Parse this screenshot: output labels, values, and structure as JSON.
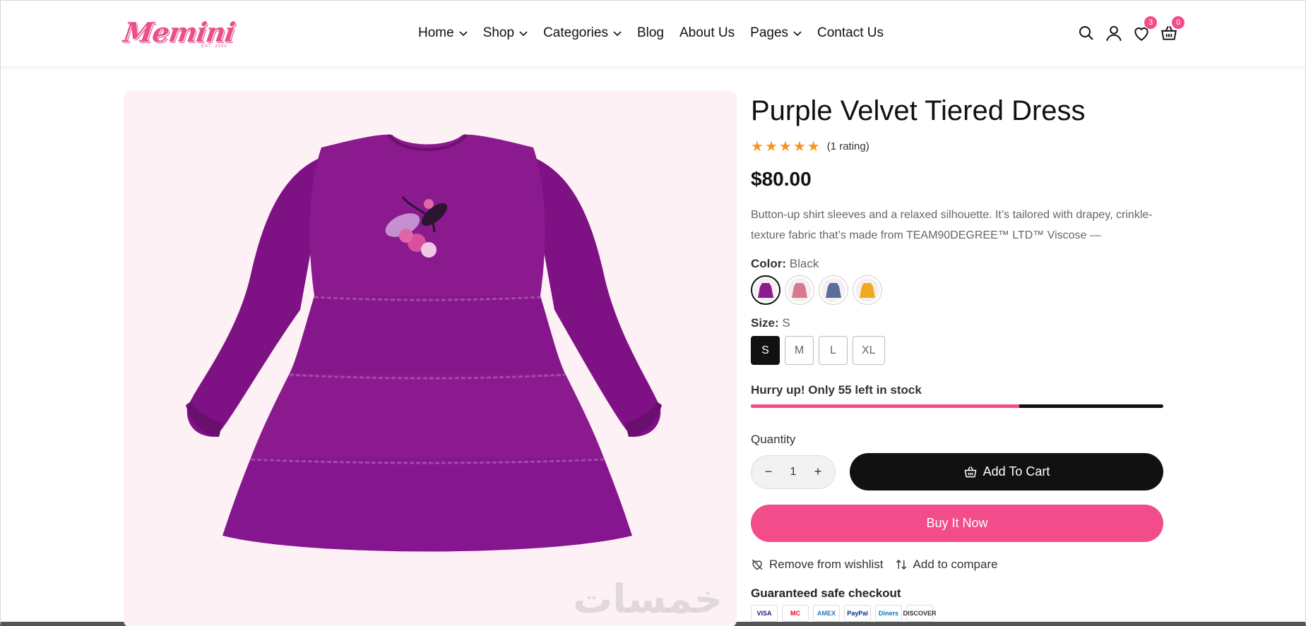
{
  "brand": {
    "name": "Memini",
    "tagline": "EST. 2020",
    "color": "#e8508b"
  },
  "nav": [
    {
      "label": "Home",
      "has_dropdown": true
    },
    {
      "label": "Shop",
      "has_dropdown": true
    },
    {
      "label": "Categories",
      "has_dropdown": true
    },
    {
      "label": "Blog",
      "has_dropdown": false
    },
    {
      "label": "About Us",
      "has_dropdown": false
    },
    {
      "label": "Pages",
      "has_dropdown": true
    },
    {
      "label": "Contact Us",
      "has_dropdown": false
    }
  ],
  "header_icons": {
    "search": "search-icon",
    "account": "user-icon",
    "wishlist": "heart-icon",
    "wishlist_count": "3",
    "cart": "basket-icon",
    "cart_count": "0"
  },
  "product": {
    "title": "Purple Velvet Tiered Dress",
    "rating_stars": 5,
    "rating_text": "(1 rating)",
    "price": "$80.00",
    "description": "Button-up shirt sleeves and a relaxed silhouette. It’s tailored with drapey, crinkle-texture fabric that’s made from TEAM90DEGREE™ LTD™ Viscose —",
    "color_label": "Color:",
    "color_value": "Black",
    "swatches": [
      {
        "name": "purple-dress",
        "color": "#8a1a8e",
        "active": true
      },
      {
        "name": "pink-floral-dress",
        "color": "#d9788c",
        "active": false
      },
      {
        "name": "blue-plaid-shirt",
        "color": "#5a6d9a",
        "active": false
      },
      {
        "name": "yellow-dress",
        "color": "#f2a81d",
        "active": false
      }
    ],
    "size_label": "Size:",
    "size_value": "S",
    "sizes": [
      {
        "label": "S",
        "active": true
      },
      {
        "label": "M",
        "active": false
      },
      {
        "label": "L",
        "active": false
      },
      {
        "label": "XL",
        "active": false
      }
    ],
    "stock_text": "Hurry up! Only 55 left in stock",
    "stock_fraction": 0.65,
    "quantity_label": "Quantity",
    "quantity": "1",
    "qty_minus": "−",
    "qty_plus": "+",
    "add_to_cart": "Add To Cart",
    "buy_now": "Buy It Now",
    "remove_wishlist": "Remove from wishlist",
    "add_compare": "Add to compare",
    "safe_checkout": "Guaranteed safe checkout",
    "payments": [
      "VISA",
      "MC",
      "AMEX",
      "PayPal",
      "Diners",
      "DISCOVER"
    ]
  },
  "watermark": "خمسات",
  "colors": {
    "accent": "#f24c8a",
    "dark": "#111111",
    "star": "#f7941d",
    "gallery_bg": "#fdf1f5"
  }
}
